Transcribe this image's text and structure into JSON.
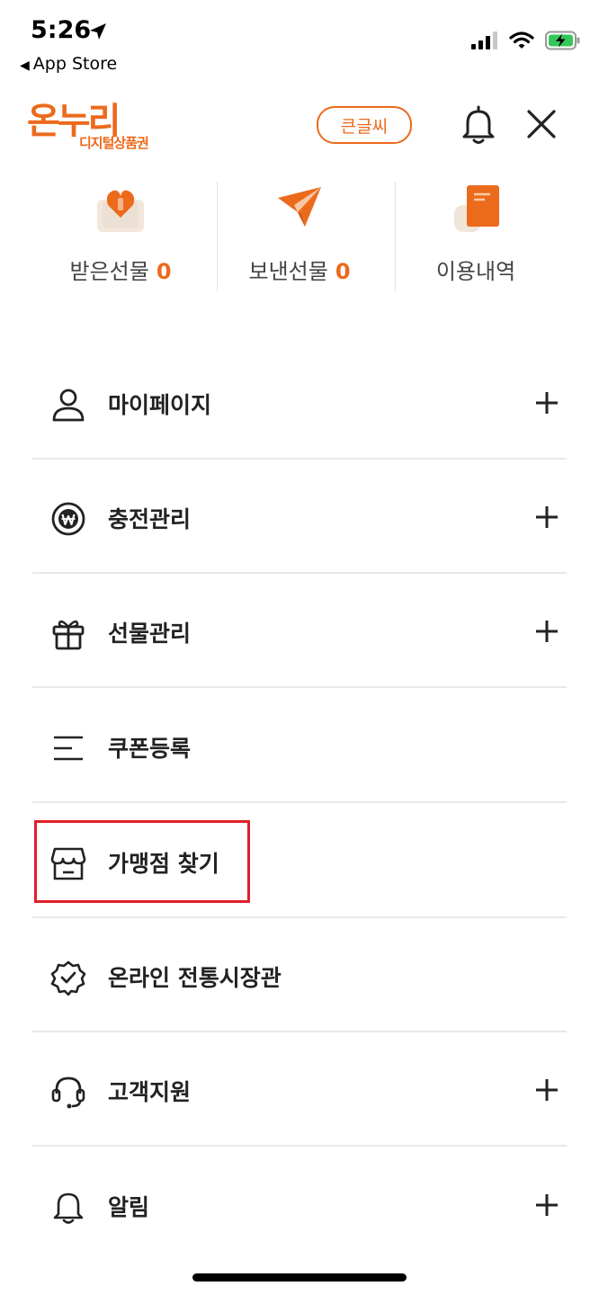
{
  "status_bar": {
    "time": "5:26",
    "back_label": "App Store"
  },
  "header": {
    "logo_main": "온누리",
    "logo_sub": "디지털상품권",
    "big_font_label": "큰글씨",
    "icons": [
      "bell-icon",
      "close-icon"
    ]
  },
  "quick_menu": [
    {
      "label": "받은선물",
      "count": "0",
      "icon": "received-gift-icon"
    },
    {
      "label": "보낸선물",
      "count": "0",
      "icon": "sent-gift-icon"
    },
    {
      "label": "이용내역",
      "count": "",
      "icon": "history-icon"
    }
  ],
  "menu": [
    {
      "label": "마이페이지",
      "icon": "user-icon",
      "expandable": true
    },
    {
      "label": "충전관리",
      "icon": "won-coin-icon",
      "expandable": true
    },
    {
      "label": "선물관리",
      "icon": "gift-icon",
      "expandable": true
    },
    {
      "label": "쿠폰등록",
      "icon": "list-lines-icon",
      "expandable": false
    },
    {
      "label": "가맹점 찾기",
      "icon": "store-icon",
      "expandable": false,
      "highlighted": true
    },
    {
      "label": "온라인 전통시장관",
      "icon": "badge-check-icon",
      "expandable": false
    },
    {
      "label": "고객지원",
      "icon": "headset-icon",
      "expandable": true
    },
    {
      "label": "알림",
      "icon": "bell-icon",
      "expandable": true
    }
  ],
  "colors": {
    "accent": "#ec6a1c",
    "highlight": "#e01f2a",
    "divider": "#e8e8e8"
  }
}
